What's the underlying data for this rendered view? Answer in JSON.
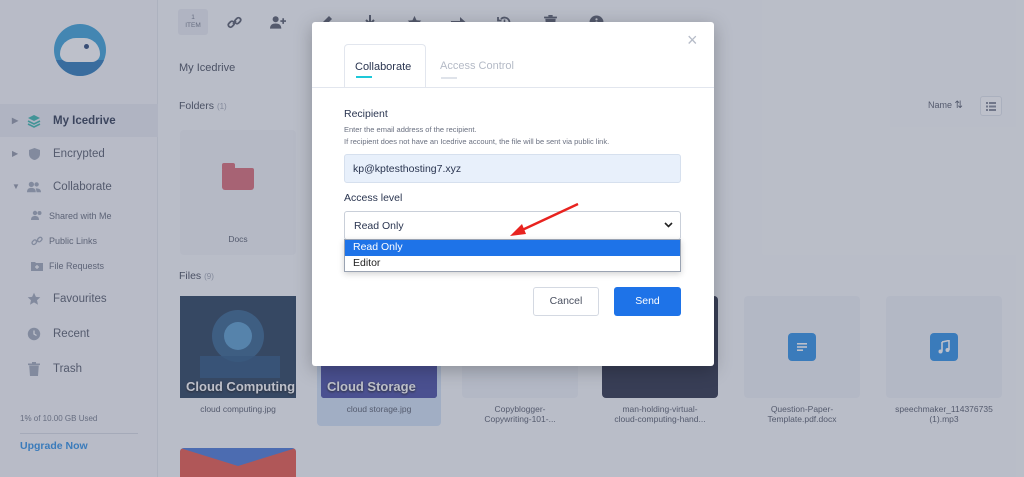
{
  "sidebar": {
    "nav": [
      {
        "label": "My Icedrive",
        "icon": "layers-icon",
        "active": true
      },
      {
        "label": "Encrypted",
        "icon": "shield-icon"
      },
      {
        "label": "Collaborate",
        "icon": "users-icon"
      }
    ],
    "sub": [
      {
        "label": "Shared with Me",
        "icon": "users-small-icon"
      },
      {
        "label": "Public Links",
        "icon": "link-icon"
      },
      {
        "label": "File Requests",
        "icon": "folder-request-icon"
      }
    ],
    "nav2": [
      {
        "label": "Favourites",
        "icon": "star-icon"
      },
      {
        "label": "Recent",
        "icon": "clock-icon"
      },
      {
        "label": "Trash",
        "icon": "trash-icon"
      }
    ],
    "usage": "1% of 10.00 GB Used",
    "upgrade": "Upgrade Now"
  },
  "toolbar": {
    "count_num": "1",
    "count_label": "ITEM"
  },
  "main": {
    "breadcrumb": "My Icedrive",
    "folders_label": "Folders",
    "folders_count": "(1)",
    "files_label": "Files",
    "files_count": "(9)",
    "sort_label": "Name",
    "folders": [
      {
        "name": "Docs"
      }
    ],
    "files": [
      {
        "name": "cloud computing.jpg",
        "thumb": "Cloud Computing"
      },
      {
        "name": "cloud storage.jpg",
        "thumb": "Cloud Storage"
      },
      {
        "name": "Copyblogger-Copywriting-101-...",
        "line1": "Copyblogger-",
        "line2": "Copywriting-101-..."
      },
      {
        "name": "man-holding-virtual-cloud-computing-hand...",
        "line1": "man-holding-virtual-",
        "line2": "cloud-computing-hand..."
      },
      {
        "name": "Question-Paper-Template.pdf.docx",
        "line1": "Question-Paper-",
        "line2": "Template.pdf.docx"
      },
      {
        "name": "speechmaker_114376735 (1).mp3",
        "line1": "speechmaker_114376735",
        "line2": "(1).mp3"
      }
    ]
  },
  "modal": {
    "tabs": [
      {
        "label": "Collaborate",
        "active": true
      },
      {
        "label": "Access Control",
        "active": false
      }
    ],
    "recipient_label": "Recipient",
    "hint1": "Enter the email address of the recipient.",
    "hint2": "If recipient does not have an Icedrive account, the file will be sent via public link.",
    "email_value": "kp@kptesthosting7.xyz",
    "access_label": "Access level",
    "access_selected": "Read Only",
    "access_options": [
      "Read Only",
      "Editor"
    ],
    "cancel": "Cancel",
    "send": "Send",
    "close": "×"
  },
  "colors": {
    "accent": "#1e73e8",
    "tab_indicator": "#1ec8d8",
    "folder": "#d95f6b",
    "arrow": "#e8231f"
  }
}
